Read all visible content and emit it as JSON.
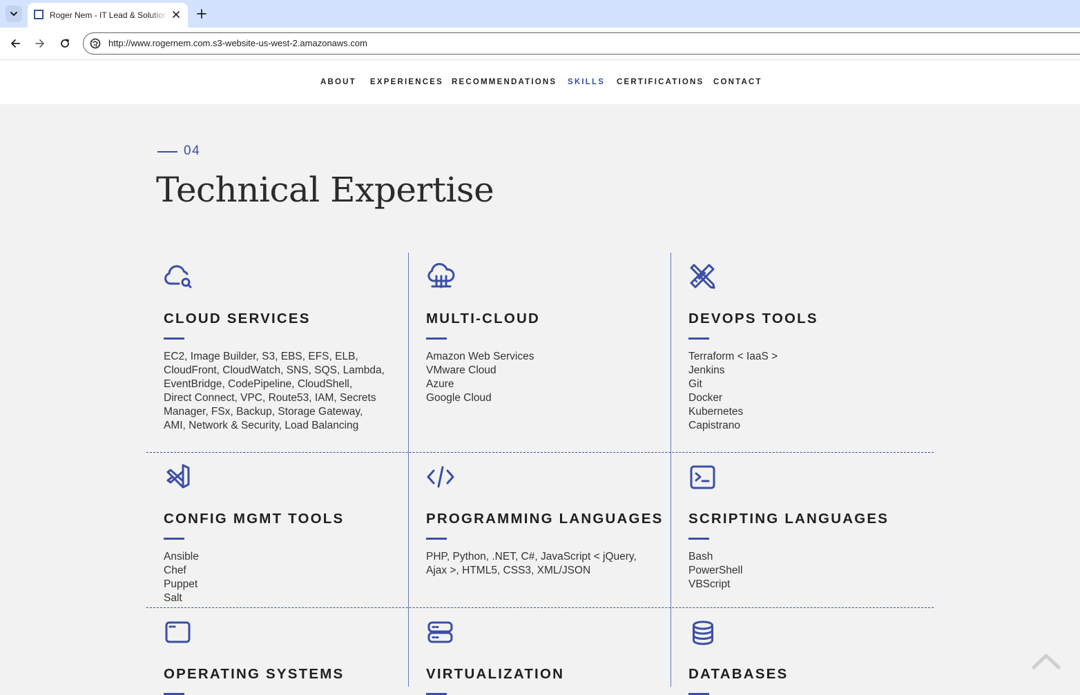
{
  "browser": {
    "tab_title": "Roger Nem - IT Lead & Solutions Architect",
    "url": "http://www.rogernem.com.s3-website-us-west-2.amazonaws.com"
  },
  "nav": {
    "items": [
      "ABOUT",
      "EXPERIENCES",
      "RECOMMENDATIONS",
      "SKILLS",
      "CERTIFICATIONS",
      "CONTACT"
    ],
    "active": "SKILLS",
    "active_color": "#3b4ea5"
  },
  "section": {
    "number": "04",
    "title": "Technical Expertise"
  },
  "accent_color": "#3b4ea5",
  "cards": [
    {
      "icon": "cloud-search-icon",
      "title": "CLOUD SERVICES",
      "lines": [
        "EC2, Image Builder, S3, EBS, EFS, ELB,",
        "CloudFront, CloudWatch, SNS, SQS, Lambda,",
        "EventBridge, CodePipeline, CloudShell,",
        "Direct Connect, VPC, Route53, IAM, Secrets",
        "Manager, FSx, Backup, Storage Gateway,",
        "AMI, Network & Security, Load Balancing"
      ]
    },
    {
      "icon": "cloud-network-icon",
      "title": "MULTI-CLOUD",
      "lines": [
        "Amazon Web Services",
        "VMware Cloud",
        "Azure",
        "Google Cloud"
      ]
    },
    {
      "icon": "design-tools-icon",
      "title": "DEVOPS TOOLS",
      "lines": [
        "Terraform < IaaS >",
        "Jenkins",
        "Git",
        "Docker",
        "Kubernetes",
        "Capistrano"
      ]
    },
    {
      "icon": "vscode-icon",
      "title": "CONFIG MGMT TOOLS",
      "lines": [
        "Ansible",
        "Chef",
        "Puppet",
        "Salt"
      ]
    },
    {
      "icon": "code-icon",
      "title": "PROGRAMMING LANGUAGES",
      "lines": [
        "PHP, Python, .NET, C#, JavaScript < jQuery,",
        "Ajax >, HTML5, CSS3, XML/JSON"
      ]
    },
    {
      "icon": "terminal-icon",
      "title": "SCRIPTING LANGUAGES",
      "lines": [
        "Bash",
        "PowerShell",
        "VBScript"
      ]
    },
    {
      "icon": "app-window-icon",
      "title": "OPERATING SYSTEMS",
      "lines": []
    },
    {
      "icon": "server-icon",
      "title": "VIRTUALIZATION",
      "lines": []
    },
    {
      "icon": "database-icon",
      "title": "DATABASES",
      "lines": []
    }
  ]
}
